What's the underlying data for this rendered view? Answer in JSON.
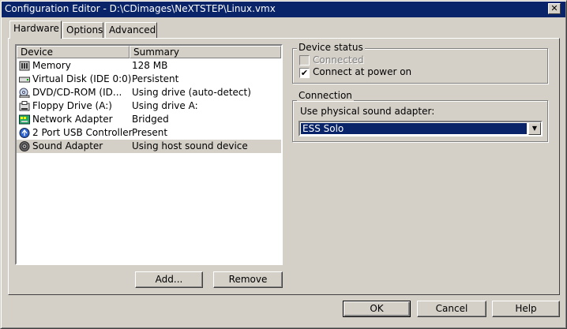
{
  "window": {
    "title": "Configuration Editor - D:\\CDimages\\NeXTSTEP\\Linux.vmx",
    "close_glyph": "✕"
  },
  "tabs": [
    {
      "label": "Hardware"
    },
    {
      "label": "Options"
    },
    {
      "label": "Advanced"
    }
  ],
  "device_list": {
    "columns": [
      "Device",
      "Summary"
    ],
    "rows": [
      {
        "icon": "memory-icon",
        "device": "Memory",
        "summary": "128 MB"
      },
      {
        "icon": "hard-disk-icon",
        "device": "Virtual Disk (IDE 0:0)",
        "summary": "Persistent"
      },
      {
        "icon": "cdrom-icon",
        "device": "DVD/CD-ROM (ID...",
        "summary": "Using drive (auto-detect)"
      },
      {
        "icon": "floppy-icon",
        "device": "Floppy Drive (A:)",
        "summary": "Using drive A:"
      },
      {
        "icon": "network-icon",
        "device": "Network Adapter",
        "summary": "Bridged"
      },
      {
        "icon": "usb-icon",
        "device": "2 Port USB Controller",
        "summary": "Present"
      },
      {
        "icon": "sound-icon",
        "device": "Sound Adapter",
        "summary": "Using host sound device"
      }
    ],
    "selected_index": 6
  },
  "list_buttons": {
    "add": "Add...",
    "remove": "Remove"
  },
  "device_status": {
    "legend": "Device status",
    "connected": {
      "label": "Connected",
      "checked": false,
      "disabled": true
    },
    "connect_power_on": {
      "label": "Connect at power on",
      "checked": true
    }
  },
  "connection": {
    "legend": "Connection",
    "label": "Use physical sound adapter:",
    "selected": "ESS Solo"
  },
  "footer": {
    "ok": "OK",
    "cancel": "Cancel",
    "help": "Help"
  },
  "colors": {
    "face": "#d4d0c8",
    "titlebar": "#0a246a",
    "highlight": "#0a246a"
  }
}
